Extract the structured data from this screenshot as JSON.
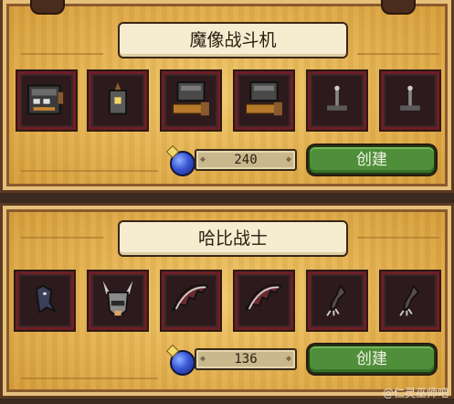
{
  "recipes": [
    {
      "title": "魔像战斗机",
      "cost": "240",
      "create_label": "创建",
      "slots": [
        "golem-furnace-icon",
        "lantern-core-icon",
        "armored-chest-arm-icon",
        "armored-chest-arm-icon",
        "lever-icon",
        "lever-icon"
      ]
    },
    {
      "title": "哈比战士",
      "cost": "136",
      "create_label": "创建",
      "slots": [
        "harpy-body-icon",
        "horned-helmet-icon",
        "bat-wing-icon",
        "bat-wing-icon",
        "talon-icon",
        "talon-icon"
      ]
    }
  ],
  "currency_icon": "mana-orb-icon",
  "watermark": "@仁灵巫师吧",
  "colors": {
    "parchment": "#e2ad4a",
    "slot_border": "#6e1e26",
    "create_button": "#4f8f3a"
  }
}
